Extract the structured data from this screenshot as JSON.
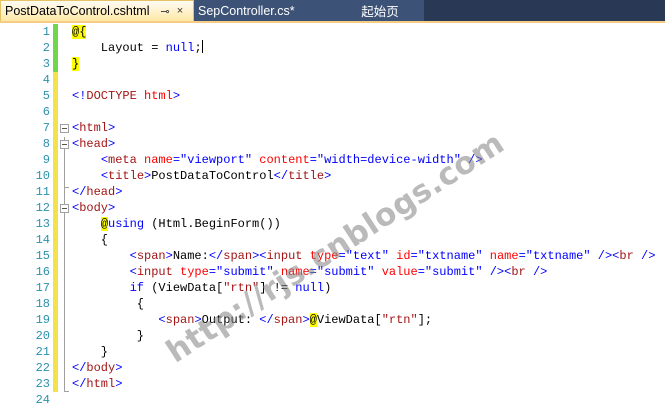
{
  "tabs": [
    {
      "label": "PostDataToControl.cshtml",
      "pin": "⊸",
      "close": "×"
    },
    {
      "label": "SepController.cs*"
    },
    {
      "label": "起始页"
    }
  ],
  "colors": {
    "tab_strip": "#293955",
    "active_tab": "#ffe8a6",
    "line_numbers": "#2b91af",
    "razor_highlight": "#ffff00",
    "tag_name": "#a31515",
    "attr_name": "#ff0000",
    "punctuation": "#0000ff"
  },
  "lines": [
    {
      "n": "1",
      "tokens": [
        [
          "razor",
          "@{"
        ]
      ]
    },
    {
      "n": "2",
      "tokens": [
        [
          "black",
          "    Layout = "
        ],
        [
          "blue",
          "null"
        ],
        [
          "black",
          ";"
        ]
      ],
      "cursor": true
    },
    {
      "n": "3",
      "tokens": [
        [
          "razor",
          "}"
        ]
      ]
    },
    {
      "n": "4",
      "tokens": []
    },
    {
      "n": "5",
      "tokens": [
        [
          "blue",
          "<!"
        ],
        [
          "brown",
          "DOCTYPE"
        ],
        [
          "black",
          " "
        ],
        [
          "red",
          "html"
        ],
        [
          "blue",
          ">"
        ]
      ]
    },
    {
      "n": "6",
      "tokens": []
    },
    {
      "n": "7",
      "tokens": [
        [
          "blue",
          "<"
        ],
        [
          "brown",
          "html"
        ],
        [
          "blue",
          ">"
        ]
      ]
    },
    {
      "n": "8",
      "tokens": [
        [
          "blue",
          "<"
        ],
        [
          "brown",
          "head"
        ],
        [
          "blue",
          ">"
        ]
      ]
    },
    {
      "n": "9",
      "tokens": [
        [
          "black",
          "    "
        ],
        [
          "blue",
          "<"
        ],
        [
          "brown",
          "meta"
        ],
        [
          "black",
          " "
        ],
        [
          "red",
          "name"
        ],
        [
          "blue",
          "=\"viewport\""
        ],
        [
          "black",
          " "
        ],
        [
          "red",
          "content"
        ],
        [
          "blue",
          "=\"width=device-width\""
        ],
        [
          "black",
          " "
        ],
        [
          "blue",
          "/>"
        ]
      ]
    },
    {
      "n": "10",
      "tokens": [
        [
          "black",
          "    "
        ],
        [
          "blue",
          "<"
        ],
        [
          "brown",
          "title"
        ],
        [
          "blue",
          ">"
        ],
        [
          "black",
          "PostDataToControl"
        ],
        [
          "blue",
          "</"
        ],
        [
          "brown",
          "title"
        ],
        [
          "blue",
          ">"
        ]
      ]
    },
    {
      "n": "11",
      "tokens": [
        [
          "blue",
          "</"
        ],
        [
          "brown",
          "head"
        ],
        [
          "blue",
          ">"
        ]
      ]
    },
    {
      "n": "12",
      "tokens": [
        [
          "blue",
          "<"
        ],
        [
          "brown",
          "body"
        ],
        [
          "blue",
          ">"
        ]
      ]
    },
    {
      "n": "13",
      "tokens": [
        [
          "black",
          "    "
        ],
        [
          "razor",
          "@"
        ],
        [
          "blue",
          "using"
        ],
        [
          "black",
          " (Html.BeginForm())"
        ]
      ]
    },
    {
      "n": "14",
      "tokens": [
        [
          "black",
          "    {"
        ]
      ]
    },
    {
      "n": "15",
      "tokens": [
        [
          "black",
          "        "
        ],
        [
          "blue",
          "<"
        ],
        [
          "brown",
          "span"
        ],
        [
          "blue",
          ">"
        ],
        [
          "black",
          "Name:"
        ],
        [
          "blue",
          "</"
        ],
        [
          "brown",
          "span"
        ],
        [
          "blue",
          "><"
        ],
        [
          "brown",
          "input"
        ],
        [
          "black",
          " "
        ],
        [
          "red",
          "type"
        ],
        [
          "blue",
          "=\"text\""
        ],
        [
          "black",
          " "
        ],
        [
          "red",
          "id"
        ],
        [
          "blue",
          "=\"txtname\""
        ],
        [
          "black",
          " "
        ],
        [
          "red",
          "name"
        ],
        [
          "blue",
          "=\"txtname\""
        ],
        [
          "black",
          " "
        ],
        [
          "blue",
          "/><"
        ],
        [
          "brown",
          "br"
        ],
        [
          "black",
          " "
        ],
        [
          "blue",
          "/>"
        ]
      ]
    },
    {
      "n": "16",
      "tokens": [
        [
          "black",
          "        "
        ],
        [
          "blue",
          "<"
        ],
        [
          "brown",
          "input"
        ],
        [
          "black",
          " "
        ],
        [
          "red",
          "type"
        ],
        [
          "blue",
          "=\"submit\""
        ],
        [
          "black",
          " "
        ],
        [
          "red",
          "name"
        ],
        [
          "blue",
          "=\"submit\""
        ],
        [
          "black",
          " "
        ],
        [
          "red",
          "value"
        ],
        [
          "blue",
          "=\"submit\""
        ],
        [
          "black",
          " "
        ],
        [
          "blue",
          "/><"
        ],
        [
          "brown",
          "br"
        ],
        [
          "black",
          " "
        ],
        [
          "blue",
          "/>"
        ]
      ]
    },
    {
      "n": "17",
      "tokens": [
        [
          "black",
          "        "
        ],
        [
          "blue",
          "if"
        ],
        [
          "black",
          " (ViewData["
        ],
        [
          "brown",
          "\"rtn\""
        ],
        [
          "black",
          "] != "
        ],
        [
          "blue",
          "null"
        ],
        [
          "black",
          ")"
        ]
      ]
    },
    {
      "n": "18",
      "tokens": [
        [
          "black",
          "         {"
        ]
      ]
    },
    {
      "n": "19",
      "tokens": [
        [
          "black",
          "            "
        ],
        [
          "blue",
          "<"
        ],
        [
          "brown",
          "span"
        ],
        [
          "blue",
          ">"
        ],
        [
          "black",
          "Output: "
        ],
        [
          "blue",
          "</"
        ],
        [
          "brown",
          "span"
        ],
        [
          "blue",
          ">"
        ],
        [
          "razor",
          "@"
        ],
        [
          "black",
          "ViewData["
        ],
        [
          "brown",
          "\"rtn\""
        ],
        [
          "black",
          "];"
        ]
      ]
    },
    {
      "n": "20",
      "tokens": [
        [
          "black",
          "         }"
        ]
      ]
    },
    {
      "n": "21",
      "tokens": [
        [
          "black",
          "    }"
        ]
      ]
    },
    {
      "n": "22",
      "tokens": [
        [
          "blue",
          "</"
        ],
        [
          "brown",
          "body"
        ],
        [
          "blue",
          ">"
        ]
      ]
    },
    {
      "n": "23",
      "tokens": [
        [
          "blue",
          "</"
        ],
        [
          "brown",
          "html"
        ],
        [
          "blue",
          ">"
        ]
      ]
    },
    {
      "n": "24",
      "tokens": []
    }
  ],
  "watermark": "http://rjs.cnblogs.com"
}
